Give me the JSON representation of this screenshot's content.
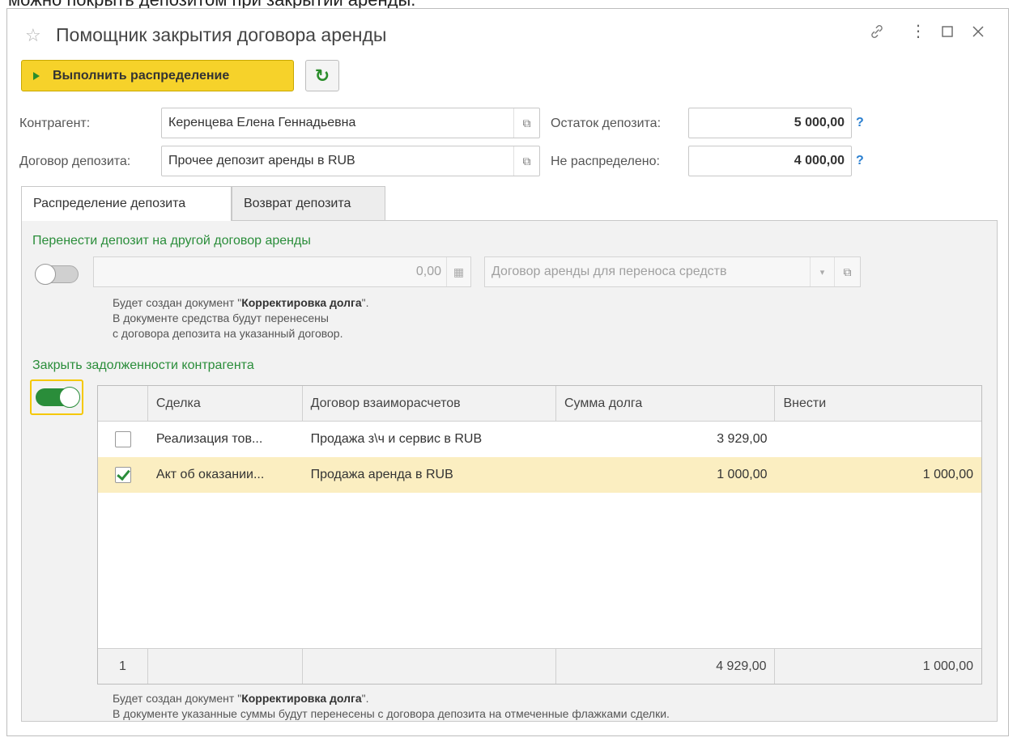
{
  "caption": "можно покрыть депозитом при закрытии аренды.",
  "window": {
    "title": "Помощник закрытия договора аренды"
  },
  "toolbar": {
    "run_label": "Выполнить распределение"
  },
  "form": {
    "counterparty_label": "Контрагент:",
    "counterparty_value": "Керенцева Елена Геннадьевна",
    "deposit_contract_label": "Договор депозита:",
    "deposit_contract_value": "Прочее депозит аренды в RUB",
    "deposit_balance_label": "Остаток депозита:",
    "deposit_balance_value": "5 000,00",
    "undistributed_label": "Не распределено:",
    "undistributed_value": "4 000,00",
    "help_glyph": "?"
  },
  "tabs": [
    {
      "label": "Распределение депозита",
      "active": true
    },
    {
      "label": "Возврат депозита",
      "active": false
    }
  ],
  "transfer": {
    "title": "Перенести депозит на другой договор аренды",
    "amount": "0,00",
    "contract_placeholder": "Договор аренды для переноса средств",
    "note_prefix": "Будет создан документ \"",
    "note_doc": "Корректировка долга",
    "note_suffix": "\".",
    "note_line2": "В документе средства будут перенесены",
    "note_line3": "с договора депозита на указанный договор."
  },
  "close_debts": {
    "title": "Закрыть задолженности контрагента",
    "columns": [
      "Сделка",
      "Договор взаиморасчетов",
      "Сумма долга",
      "Внести"
    ],
    "rows": [
      {
        "checked": false,
        "deal": "Реализация тов...",
        "contract": "Продажа з\\ч и сервис в RUB",
        "debt": "3 929,00",
        "pay": ""
      },
      {
        "checked": true,
        "deal": "Акт об оказании...",
        "contract": "Продажа аренда в RUB",
        "debt": "1 000,00",
        "pay": "1 000,00"
      }
    ],
    "footer": {
      "count": "1",
      "debt_total": "4 929,00",
      "pay_total": "1 000,00"
    },
    "note_prefix": "Будет создан документ \"",
    "note_doc": "Корректировка долга",
    "note_suffix": "\".",
    "note_line2": "В документе указанные суммы будут перенесены с договора депозита на отмеченные флажками сделки."
  }
}
